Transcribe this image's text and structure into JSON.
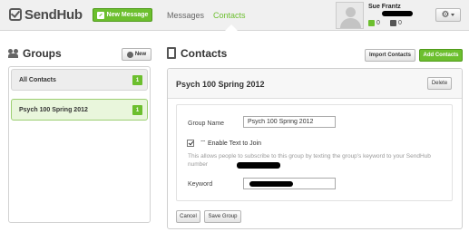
{
  "header": {
    "logo_text": "SendHub",
    "new_message_label": "New Message",
    "nav": {
      "messages": "Messages",
      "contacts": "Contacts"
    },
    "user": {
      "name": "Sue Frantz",
      "stat_green": "0",
      "stat_dark": "0"
    },
    "settings_icon": "gear-icon"
  },
  "groups": {
    "title": "Groups",
    "new_label": "New",
    "items": [
      {
        "label": "All Contacts",
        "count": "1",
        "selected": false
      },
      {
        "label": "Psych 100 Spring 2012",
        "count": "1",
        "selected": true
      }
    ]
  },
  "contacts": {
    "title": "Contacts",
    "import_label": "Import Contacts",
    "add_label": "Add Contacts"
  },
  "group_detail": {
    "title": "Psych 100 Spring 2012",
    "delete_label": "Delete",
    "group_name_label": "Group Name",
    "group_name_value": "Psych 100 Spring 2012",
    "enable_text_label": "Enable Text to Join",
    "enable_text_checked": true,
    "help_text": "This allows people to subscribe to this group by texting the group's keyword to your SendHub number",
    "keyword_label": "Keyword",
    "cancel_label": "Cancel",
    "save_label": "Save Group"
  },
  "colors": {
    "brand_green": "#6cbf2e",
    "selected_bg": "#e9f6dc"
  }
}
